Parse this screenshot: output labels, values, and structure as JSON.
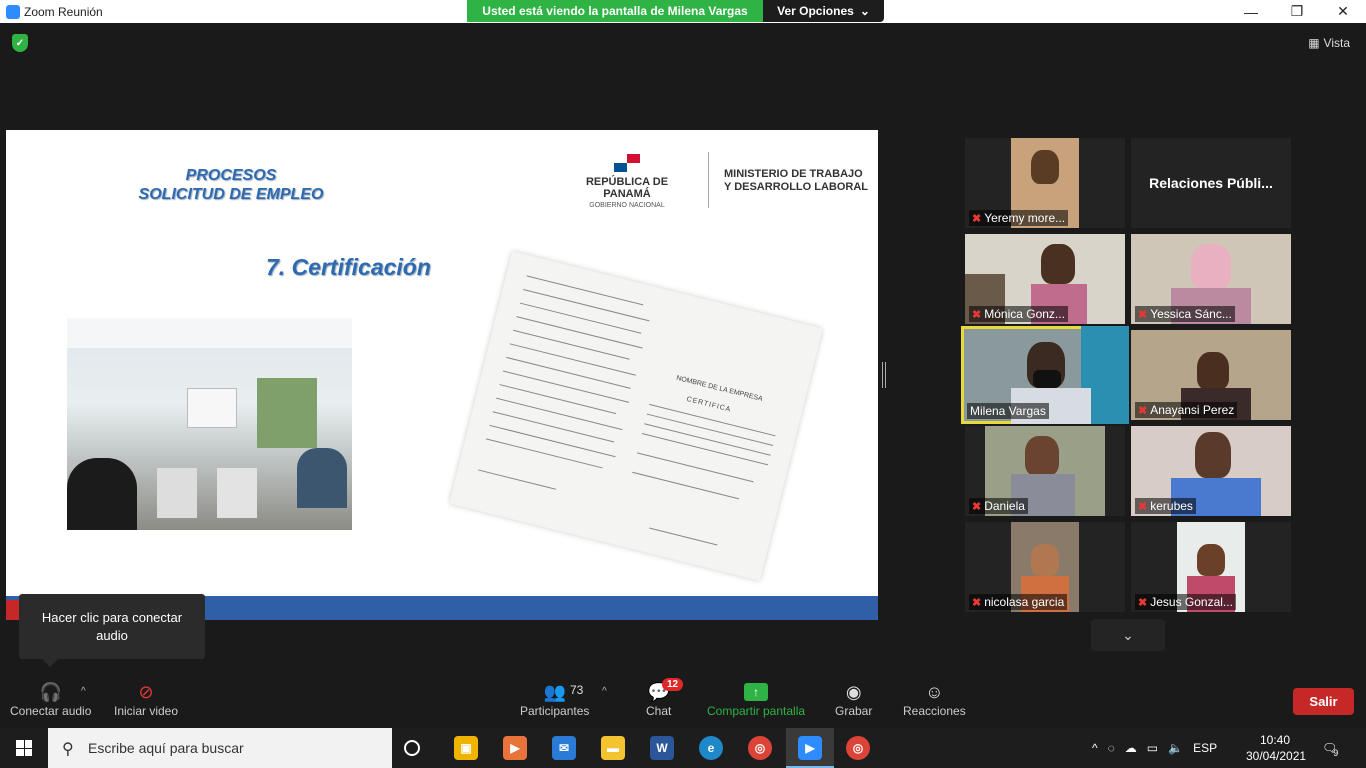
{
  "window": {
    "title": "Zoom Reunión",
    "share_banner": "Usted está viendo la pantalla de Milena Vargas",
    "view_options": "Ver Opciones",
    "view_label": "Vista"
  },
  "slide": {
    "title_line1": "PROCESOS",
    "title_line2": "SOLICITUD DE EMPLEO",
    "section_title": "7. Certificación",
    "logo_country": "REPÚBLICA DE PANAMÁ",
    "logo_gov": "GOBIERNO NACIONAL",
    "ministry_line1": "MINISTERIO DE TRABAJO",
    "ministry_line2": "Y DESARROLLO LABORAL",
    "document_heading": "CERTIFICA",
    "document_subheading": "NOMBRE DE LA EMPRESA"
  },
  "participants": [
    {
      "name": "Yeremy more...",
      "muted": true
    },
    {
      "name": "Relaciones  Públi...",
      "muted": false,
      "text_only": true
    },
    {
      "name": "Mónica Gonz...",
      "muted": true
    },
    {
      "name": "Yessica Sánc...",
      "muted": true
    },
    {
      "name": "Milena Vargas",
      "muted": false,
      "active": true
    },
    {
      "name": "Anayansi Perez",
      "muted": true
    },
    {
      "name": "Daniela",
      "muted": true
    },
    {
      "name": "kerubes",
      "muted": true
    },
    {
      "name": "nicolasa garcia",
      "muted": true
    },
    {
      "name": "Jesus Gonzal...",
      "muted": true
    }
  ],
  "tooltip": "Hacer clic para conectar audio",
  "toolbar": {
    "audio": "Conectar audio",
    "video": "Iniciar video",
    "participants": "Participantes",
    "participants_count": "73",
    "chat": "Chat",
    "chat_badge": "12",
    "share": "Compartir pantalla",
    "record": "Grabar",
    "reactions": "Reacciones",
    "leave": "Salir"
  },
  "taskbar": {
    "search_placeholder": "Escribe aquí para buscar",
    "language": "ESP",
    "time": "10:40",
    "date": "30/04/2021",
    "notifications": "9"
  },
  "colors": {
    "share_green": "#2fb344",
    "leave_red": "#c62828",
    "slide_blue": "#2f6ab0",
    "active_speaker": "#e6d83d"
  }
}
